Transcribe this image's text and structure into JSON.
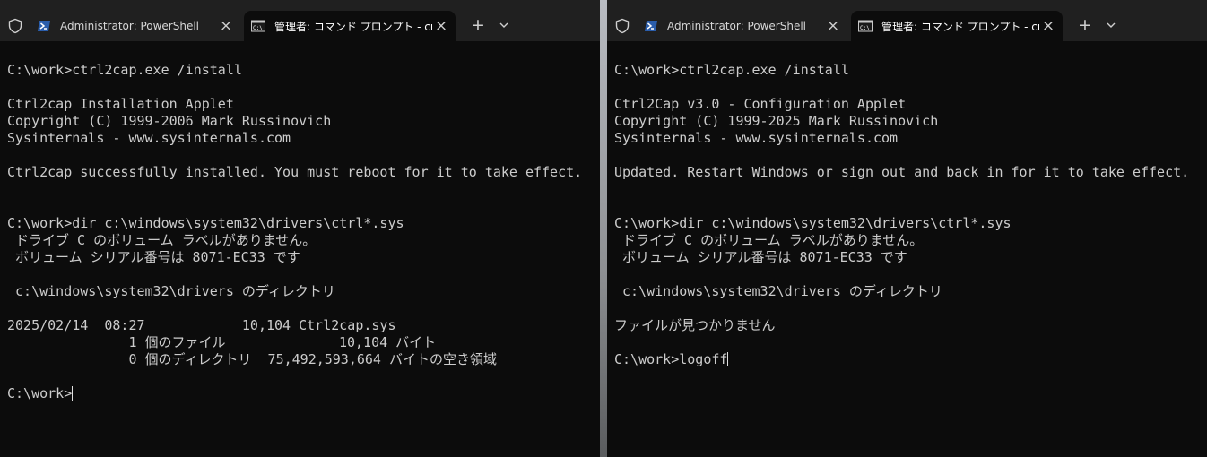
{
  "left": {
    "tabs": [
      {
        "label": "Administrator: PowerShell",
        "icon": "powershell-icon"
      },
      {
        "label": "管理者: コマンド プロンプト - cmd",
        "icon": "cmd-icon"
      }
    ],
    "lines": [
      "C:\\work>ctrl2cap.exe /install",
      "",
      "Ctrl2cap Installation Applet",
      "Copyright (C) 1999-2006 Mark Russinovich",
      "Sysinternals - www.sysinternals.com",
      "",
      "Ctrl2cap successfully installed. You must reboot for it to take effect.",
      "",
      "",
      "C:\\work>dir c:\\windows\\system32\\drivers\\ctrl*.sys",
      " ドライブ C のボリューム ラベルがありません。",
      " ボリューム シリアル番号は 8071-EC33 です",
      "",
      " c:\\windows\\system32\\drivers のディレクトリ",
      "",
      "2025/02/14  08:27            10,104 Ctrl2cap.sys",
      "               1 個のファイル              10,104 バイト",
      "               0 個のディレクトリ  75,492,593,664 バイトの空き領域",
      "",
      "C:\\work>"
    ]
  },
  "right": {
    "tabs": [
      {
        "label": "Administrator: PowerShell",
        "icon": "powershell-icon"
      },
      {
        "label": "管理者: コマンド プロンプト - cmd",
        "icon": "cmd-icon"
      }
    ],
    "lines": [
      "C:\\work>ctrl2cap.exe /install",
      "",
      "Ctrl2Cap v3.0 - Configuration Applet",
      "Copyright (C) 1999-2025 Mark Russinovich",
      "Sysinternals - www.sysinternals.com",
      "",
      "Updated. Restart Windows or sign out and back in for it to take effect.",
      "",
      "",
      "C:\\work>dir c:\\windows\\system32\\drivers\\ctrl*.sys",
      " ドライブ C のボリューム ラベルがありません。",
      " ボリューム シリアル番号は 8071-EC33 です",
      "",
      " c:\\windows\\system32\\drivers のディレクトリ",
      "",
      "ファイルが見つかりません",
      "",
      "C:\\work>logoff"
    ]
  },
  "colors": {
    "terminal_bg": "#0c0c0c",
    "text": "#cccccc",
    "tabbar_bg": "#202020"
  }
}
